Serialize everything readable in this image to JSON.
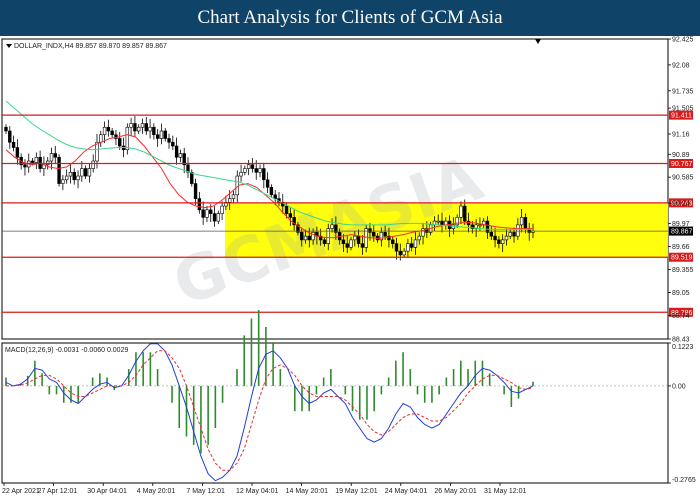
{
  "banner": {
    "title": "Chart Analysis for Clients of GCM Asia"
  },
  "chart_data": [
    {
      "type": "candlestick",
      "symbol_header": "DOLLAR_INDX,H4  89.857 89.870 89.857 89.867",
      "timeframe": "H4",
      "ylim": [
        88.43,
        92.425
      ],
      "yticks": [
        92.425,
        92.08,
        91.735,
        91.505,
        91.16,
        90.89,
        90.585,
        90.24,
        89.97,
        89.66,
        89.355,
        89.05,
        88.74,
        88.43
      ],
      "xticks": [
        "22 Apr 2021",
        "27 Apr 12:01",
        "30 Apr 04:01",
        "4 May 20:01",
        "7 May 12:01",
        "12 May 04:01",
        "14 May 20:01",
        "19 May 12:01",
        "24 May 04:01",
        "26 May 20:01",
        "31 May 12:01"
      ],
      "current_price": 89.867,
      "levels": [
        {
          "value": 91.411,
          "label": "91.411"
        },
        {
          "value": 90.767,
          "label": "90.767"
        },
        {
          "value": 90.243,
          "label": "90.243"
        },
        {
          "value": 89.519,
          "label": "89.519"
        },
        {
          "value": 88.786,
          "label": "88.786"
        }
      ],
      "range_zone": {
        "from": 89.519,
        "to": 90.243,
        "color": "#ffff00"
      },
      "closes": [
        91.2,
        91.05,
        90.98,
        90.85,
        90.75,
        90.72,
        90.8,
        90.78,
        90.85,
        90.7,
        90.75,
        90.8,
        90.9,
        90.85,
        90.5,
        90.55,
        90.6,
        90.65,
        90.55,
        90.6,
        90.7,
        90.6,
        90.7,
        90.8,
        91.05,
        91.15,
        91.25,
        91.2,
        91.15,
        91.1,
        91.0,
        90.95,
        91.25,
        91.3,
        91.2,
        91.25,
        91.3,
        91.2,
        91.25,
        91.15,
        91.1,
        91.2,
        91.1,
        91.05,
        91.0,
        90.85,
        90.9,
        90.75,
        90.65,
        90.5,
        90.3,
        90.15,
        90.05,
        90.15,
        90.1,
        90.0,
        90.1,
        90.2,
        90.25,
        90.3,
        90.35,
        90.6,
        90.65,
        90.7,
        90.75,
        90.7,
        90.65,
        90.7,
        90.55,
        90.45,
        90.35,
        90.3,
        90.25,
        90.2,
        90.1,
        90.05,
        89.95,
        89.85,
        89.75,
        89.8,
        89.75,
        89.85,
        89.8,
        89.75,
        89.7,
        89.9,
        89.95,
        89.85,
        89.75,
        89.7,
        89.65,
        89.75,
        89.8,
        89.7,
        89.65,
        89.9,
        89.85,
        89.8,
        89.75,
        89.85,
        89.8,
        89.75,
        89.7,
        89.6,
        89.55,
        89.6,
        89.7,
        89.65,
        89.75,
        89.8,
        89.9,
        89.85,
        89.95,
        90.0,
        90.0,
        89.95,
        90.0,
        89.9,
        89.95,
        90.05,
        90.2,
        90.0,
        89.95,
        89.9,
        89.95,
        89.95,
        90.0,
        89.85,
        89.8,
        89.75,
        89.7,
        89.75,
        89.8,
        89.85,
        89.8,
        89.95,
        90.05,
        89.9,
        89.85,
        89.867
      ],
      "moving_averages": [
        {
          "color": "#ff2a2a",
          "values": [
            90.95,
            90.85,
            90.78,
            90.75,
            90.77,
            90.72,
            90.7,
            90.72,
            90.8,
            90.92,
            91.0,
            91.05,
            91.1,
            91.12,
            91.15,
            91.12,
            91.0,
            90.85,
            90.7,
            90.5,
            90.35,
            90.25,
            90.2,
            90.18,
            90.2,
            90.28,
            90.38,
            90.48,
            90.5,
            90.45,
            90.35,
            90.25,
            90.12,
            90.0,
            89.92,
            89.85,
            89.8,
            89.78,
            89.78,
            89.8,
            89.82,
            89.8,
            89.78,
            89.77,
            89.78,
            89.8,
            89.82,
            89.85,
            89.87,
            89.9,
            89.93,
            89.95,
            89.97,
            89.98,
            89.98,
            89.96,
            89.94,
            89.92,
            89.91,
            89.9,
            89.9,
            89.9
          ]
        },
        {
          "color": "#3dd68c",
          "values": [
            91.6,
            91.5,
            91.4,
            91.3,
            91.22,
            91.15,
            91.08,
            91.02,
            90.98,
            90.96,
            90.95,
            90.96,
            90.97,
            90.98,
            90.98,
            90.96,
            90.92,
            90.86,
            90.8,
            90.74,
            90.7,
            90.66,
            90.62,
            90.6,
            90.58,
            90.56,
            90.54,
            90.52,
            90.48,
            90.42,
            90.36,
            90.3,
            90.24,
            90.18,
            90.12,
            90.08,
            90.04,
            90.0,
            89.98,
            89.96,
            89.95,
            89.95,
            89.95,
            89.95,
            89.95,
            89.96,
            89.97,
            89.97,
            89.97,
            89.96,
            89.95,
            89.94,
            89.93,
            89.92,
            89.91,
            89.9,
            89.89,
            89.89,
            89.89,
            89.89,
            89.89,
            89.89
          ]
        }
      ],
      "watermark": "GCMASIA"
    },
    {
      "type": "macd",
      "header": "MACD(12,26,9) -0.0031 -0.0060 0.0029",
      "ylim": [
        -0.2765,
        0.1223
      ],
      "yticks": [
        0.1223,
        0.0,
        -0.2765
      ],
      "macd": {
        "color": "#1f3fd6",
        "values": [
          0.01,
          0.0,
          0.005,
          0.02,
          0.05,
          0.045,
          0.02,
          0.01,
          -0.02,
          -0.04,
          -0.05,
          -0.03,
          -0.01,
          0.005,
          0.01,
          -0.005,
          0.0,
          0.03,
          0.07,
          0.1,
          0.12,
          0.12,
          0.1,
          0.06,
          0.0,
          -0.06,
          -0.13,
          -0.2,
          -0.25,
          -0.27,
          -0.26,
          -0.24,
          -0.2,
          -0.12,
          -0.03,
          0.05,
          0.09,
          0.1,
          0.08,
          0.05,
          0.0,
          -0.03,
          -0.05,
          -0.04,
          -0.02,
          -0.01,
          -0.03,
          -0.05,
          -0.09,
          -0.12,
          -0.15,
          -0.16,
          -0.15,
          -0.12,
          -0.08,
          -0.05,
          -0.06,
          -0.09,
          -0.11,
          -0.12,
          -0.11,
          -0.08,
          -0.05,
          -0.02,
          0.0,
          0.03,
          0.05,
          0.045,
          0.03,
          0.01,
          -0.015,
          -0.02,
          -0.01,
          0.0
        ]
      },
      "signal": {
        "color": "#e03030",
        "values": [
          0.0,
          0.0,
          0.003,
          0.008,
          0.02,
          0.03,
          0.03,
          0.02,
          0.0,
          -0.02,
          -0.03,
          -0.03,
          -0.02,
          -0.01,
          0.0,
          0.0,
          0.0,
          0.01,
          0.03,
          0.06,
          0.08,
          0.1,
          0.1,
          0.08,
          0.05,
          0.0,
          -0.06,
          -0.12,
          -0.18,
          -0.22,
          -0.24,
          -0.24,
          -0.22,
          -0.18,
          -0.11,
          -0.04,
          0.02,
          0.05,
          0.06,
          0.05,
          0.03,
          0.0,
          -0.02,
          -0.03,
          -0.03,
          -0.03,
          -0.03,
          -0.04,
          -0.06,
          -0.08,
          -0.11,
          -0.13,
          -0.14,
          -0.13,
          -0.11,
          -0.09,
          -0.08,
          -0.08,
          -0.09,
          -0.1,
          -0.1,
          -0.09,
          -0.07,
          -0.05,
          -0.02,
          0.0,
          0.02,
          0.03,
          0.03,
          0.02,
          0.01,
          -0.005,
          -0.01,
          -0.005
        ]
      },
      "histogram_color": "#2e8b2e"
    }
  ]
}
